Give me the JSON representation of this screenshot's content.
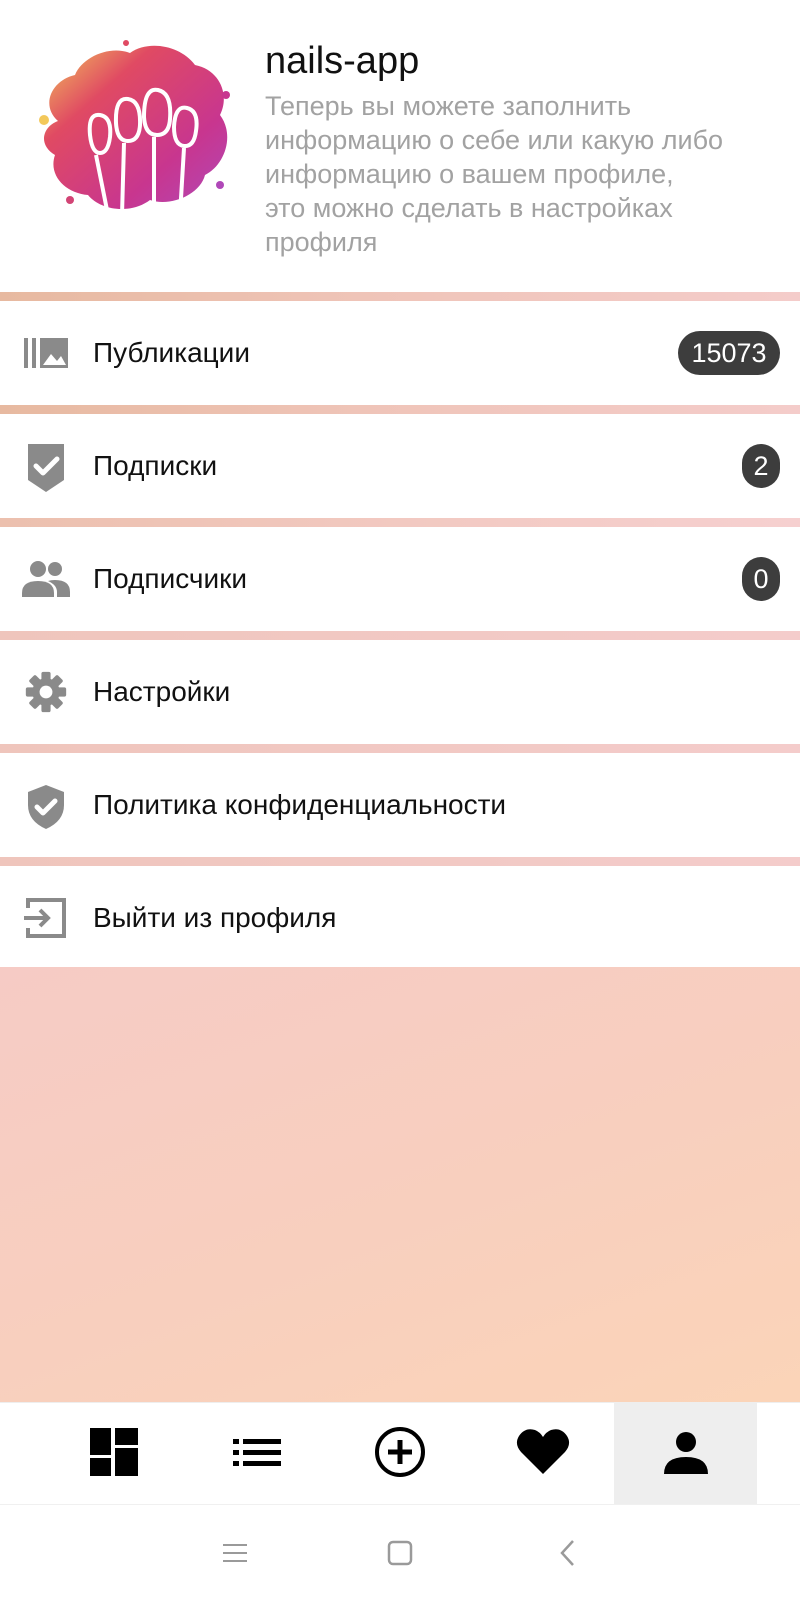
{
  "profile": {
    "app_name": "nails-app",
    "description": "Теперь вы можете заполнить\nинформацию о себе или какую либо\nинформацию о вашем профиле,\nэто можно сделать в настройках\nпрофиля",
    "logo_icon": "nails-splash-logo"
  },
  "menu": {
    "items": [
      {
        "label": "Публикации",
        "icon": "gallery-icon",
        "badge": "15073"
      },
      {
        "label": "Подписки",
        "icon": "check-badge-icon",
        "badge": "2"
      },
      {
        "label": "Подписчики",
        "icon": "people-icon",
        "badge": "0"
      },
      {
        "label": "Настройки",
        "icon": "gear-icon"
      },
      {
        "label": "Политика конфиденциальности",
        "icon": "shield-check-icon"
      },
      {
        "label": "Выйти из профиля",
        "icon": "logout-icon"
      }
    ]
  },
  "bottom_nav": {
    "items": [
      {
        "icon": "dashboard-icon",
        "active": false
      },
      {
        "icon": "list-icon",
        "active": false
      },
      {
        "icon": "add-circle-icon",
        "active": false
      },
      {
        "icon": "heart-icon",
        "active": false
      },
      {
        "icon": "person-icon",
        "active": true
      }
    ]
  },
  "system_nav": {
    "items": [
      "menu-icon",
      "home-square-icon",
      "back-chevron-icon"
    ]
  },
  "colors": {
    "badge_bg": "#3d3d3d",
    "icon_gray": "#8a8a8a",
    "separator": "#f0c4b8",
    "content_gradient_start": "#f6cbc5",
    "content_gradient_end": "#fbd4b8",
    "active_tab_bg": "#eeeeee"
  }
}
